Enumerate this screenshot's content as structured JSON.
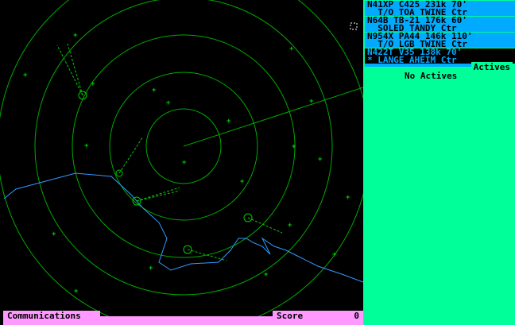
{
  "flight_strips": [
    {
      "line1": "N41XP C425 231k 70'",
      "line2": "  T/O TOA TWINE Ctr",
      "selected": false
    },
    {
      "line1": "N64B TB-21 176k 60'",
      "line2": "  SOLED TANDY Ctr",
      "selected": false
    },
    {
      "line1": "N954X PA44 146k 110'",
      "line2": "  T/O LGB TWINE Ctr",
      "selected": false
    },
    {
      "line1": "N422T V35 138k 70'",
      "line2": "* LANGE AHEIM Ctr",
      "selected": true
    }
  ],
  "actives": {
    "label": "Actives",
    "empty_text": "No Actives"
  },
  "status_bar": {
    "communications_label": "Communications",
    "score_label": "Score",
    "score_value": "0"
  },
  "colors": {
    "radar_ring": "#00aa00",
    "coast": "#3399ff",
    "strip": "#00aaff",
    "panel": "#00ff99",
    "status": "#ff99ff"
  }
}
